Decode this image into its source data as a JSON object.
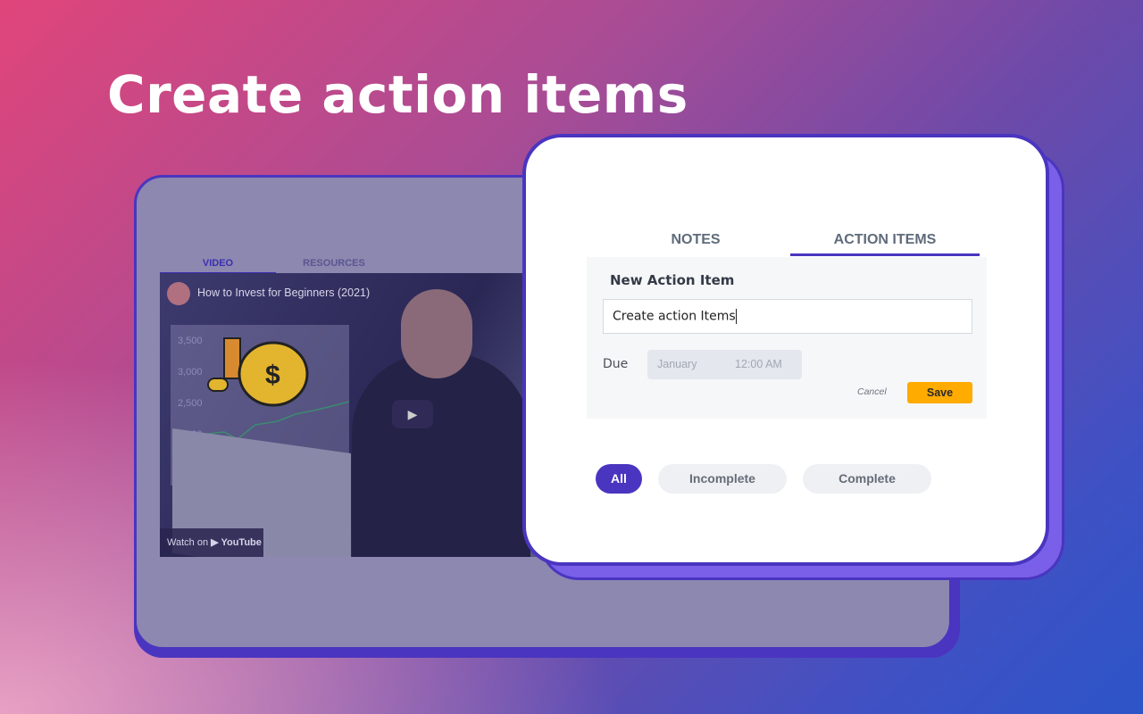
{
  "headline": "Create action items",
  "back_app": {
    "tabs": [
      {
        "label": "VIDEO",
        "active": true
      },
      {
        "label": "RESOURCES",
        "active": false
      }
    ],
    "video": {
      "title": "How to Invest for Beginners (2021)",
      "y_ticks": [
        "3,500",
        "3,000",
        "2,500",
        "2,000"
      ],
      "watch_on": "Watch on",
      "platform": "YouTube",
      "play_icon": "play-icon"
    }
  },
  "front_app": {
    "tabs": [
      {
        "label": "NOTES",
        "active": false
      },
      {
        "label": "ACTION ITEMS",
        "active": true
      }
    ],
    "form": {
      "title": "New Action Item",
      "input_value": "Create action Items",
      "due_label": "Due",
      "due_month": "January",
      "due_time": "12:00 AM",
      "cancel_label": "Cancel",
      "save_label": "Save"
    },
    "filters": [
      {
        "label": "All",
        "active": true
      },
      {
        "label": "Incomplete",
        "active": false
      },
      {
        "label": "Complete",
        "active": false
      }
    ]
  },
  "colors": {
    "accent": "#4a35c0",
    "save": "#ffab00"
  }
}
